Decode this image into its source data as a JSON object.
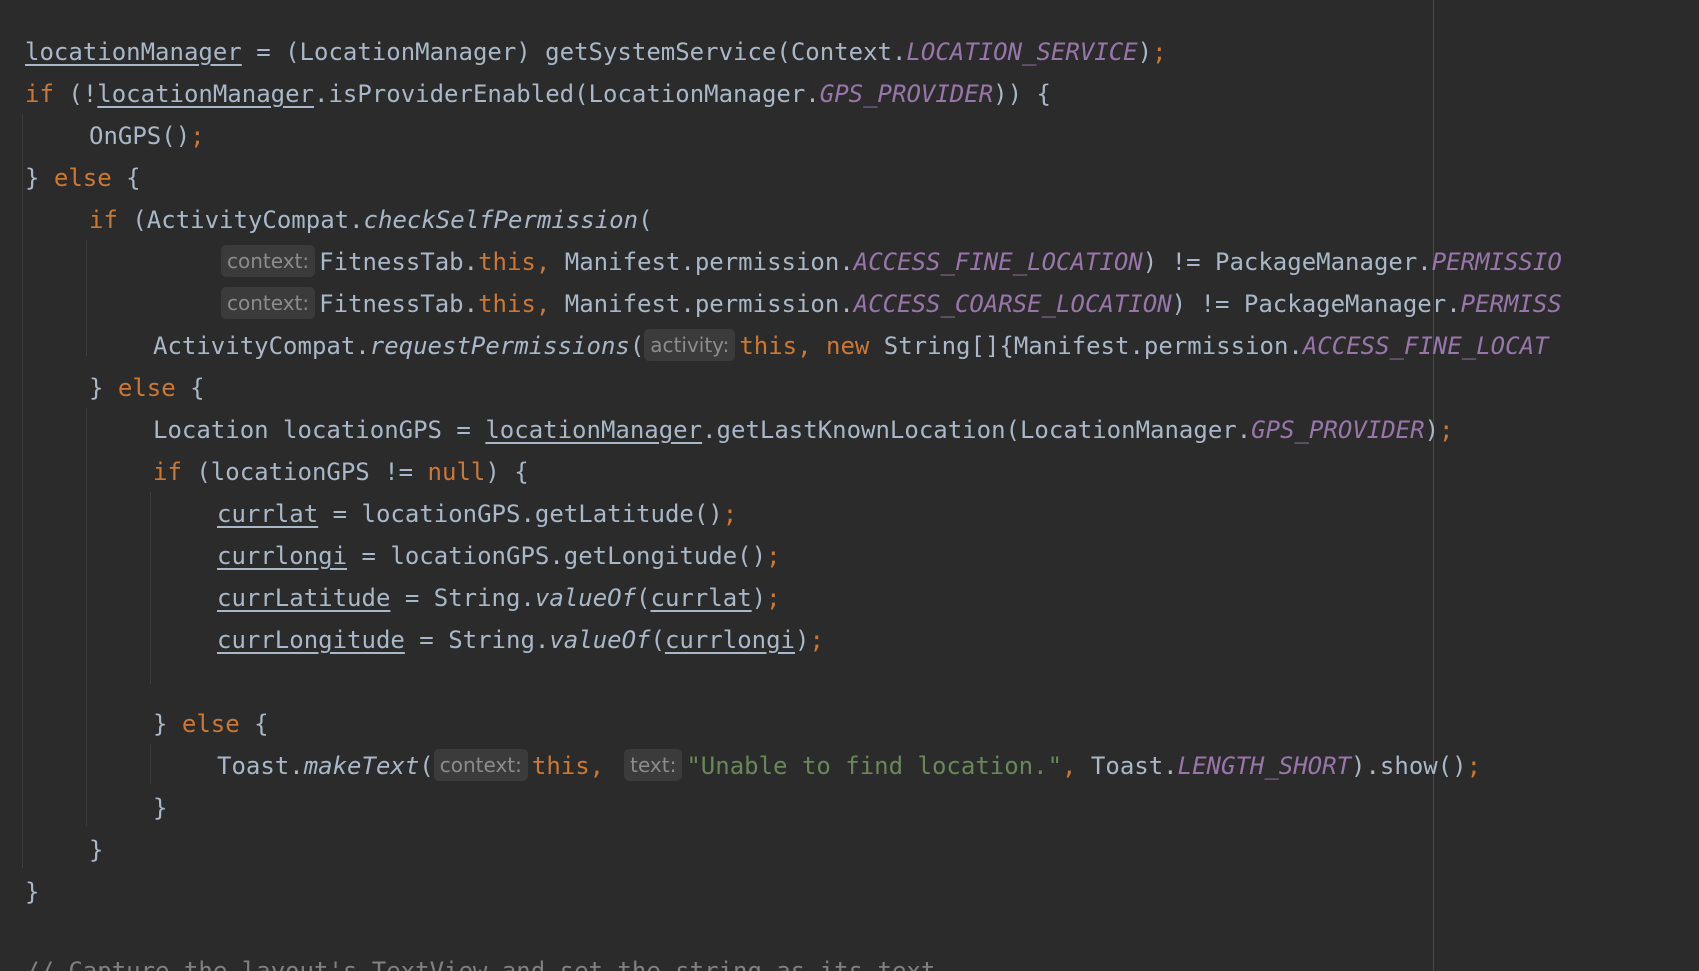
{
  "hints": {
    "context": "context:",
    "activity": "activity:",
    "text": "text:"
  },
  "code": {
    "l1": {
      "a": "locationManager",
      "b": " = (LocationManager) getSystemService(Context.",
      "c": "LOCATION_SERVICE",
      "d": ")",
      "e": ";"
    },
    "l2": {
      "a": "if",
      "b": " (!",
      "c": "locationManager",
      "d": ".isProviderEnabled(LocationManager.",
      "e": "GPS_PROVIDER",
      "f": ")) {"
    },
    "l3": {
      "a": "OnGPS()",
      "b": ";"
    },
    "l4": {
      "a": "} ",
      "b": "else",
      "c": " {"
    },
    "l5": {
      "a": "if",
      "b": " (ActivityCompat.",
      "c": "checkSelfPermission",
      "d": "("
    },
    "l6": {
      "a": "FitnessTab.",
      "b": "this,",
      "c": " Manifest.permission.",
      "d": "ACCESS_FINE_LOCATION",
      "e": ") != PackageManager.",
      "f": "PERMISSIO"
    },
    "l7": {
      "a": "FitnessTab.",
      "b": "this,",
      "c": " Manifest.permission.",
      "d": "ACCESS_COARSE_LOCATION",
      "e": ") != PackageManager.",
      "f": "PERMISS"
    },
    "l8": {
      "a": "ActivityCompat.",
      "b": "requestPermissions",
      "c": "(",
      "d": "this,",
      "e": " new",
      "f": " String[]{Manifest.permission.",
      "g": "ACCESS_FINE_LOCAT"
    },
    "l9": {
      "a": "} ",
      "b": "else",
      "c": " {"
    },
    "l10": {
      "a": "Location locationGPS = ",
      "b": "locationManager",
      "c": ".getLastKnownLocation(LocationManager.",
      "d": "GPS_PROVIDER",
      "e": ")",
      "f": ";"
    },
    "l11": {
      "a": "if",
      "b": " (locationGPS != ",
      "c": "null",
      "d": ") {"
    },
    "l12": {
      "a": "currlat",
      "b": " = locationGPS.getLatitude()",
      "c": ";"
    },
    "l13": {
      "a": "currlongi",
      "b": " = locationGPS.getLongitude()",
      "c": ";"
    },
    "l14": {
      "a": "currLatitude",
      "b": " = String.",
      "c": "valueOf",
      "d": "(",
      "e": "currlat",
      "f": ")",
      "g": ";"
    },
    "l15": {
      "a": "currLongitude",
      "b": " = String.",
      "c": "valueOf",
      "d": "(",
      "e": "currlongi",
      "f": ")",
      "g": ";"
    },
    "l16": {
      "a": "} ",
      "b": "else",
      "c": " {"
    },
    "l17": {
      "a": "Toast.",
      "b": "makeText",
      "c": "(",
      "d": "this,",
      "e": "\"Unable to find location.\"",
      "f": ",",
      "g": " Toast.",
      "h": "LENGTH_SHORT",
      "i": ").show()",
      "j": ";"
    },
    "l18": {
      "a": "}"
    },
    "l19": {
      "a": "}"
    },
    "l20": {
      "a": "}"
    },
    "l21": {
      "a": "// Capture the layout's TextView and set the string as its text"
    }
  }
}
